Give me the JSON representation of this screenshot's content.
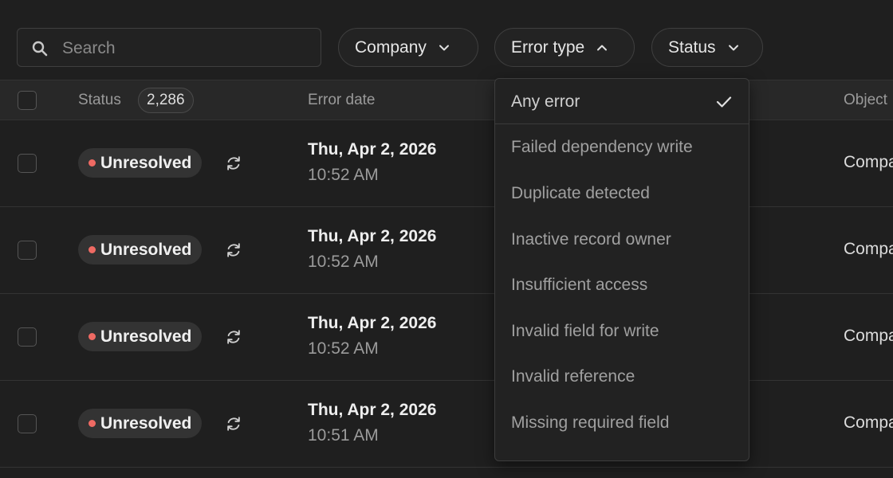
{
  "search": {
    "placeholder": "Search",
    "value": ""
  },
  "filters": {
    "company": "Company",
    "error_type": "Error type",
    "status": "Status"
  },
  "table": {
    "headers": {
      "status": "Status",
      "status_count": "2,286",
      "error_date": "Error date",
      "object": "Object"
    },
    "rows": [
      {
        "status": "Unresolved",
        "date": "Thu, Apr 2, 2026",
        "time": "10:52 AM",
        "object": "Company"
      },
      {
        "status": "Unresolved",
        "date": "Thu, Apr 2, 2026",
        "time": "10:52 AM",
        "object": "Company"
      },
      {
        "status": "Unresolved",
        "date": "Thu, Apr 2, 2026",
        "time": "10:52 AM",
        "object": "Company"
      },
      {
        "status": "Unresolved",
        "date": "Thu, Apr 2, 2026",
        "time": "10:51 AM",
        "object": "Company"
      }
    ]
  },
  "error_type_dropdown": {
    "selected": "Any error",
    "options": [
      "Any error",
      "Failed dependency write",
      "Duplicate detected",
      "Inactive record owner",
      "Insufficient access",
      "Invalid field for write",
      "Invalid reference",
      "Missing required field"
    ]
  },
  "colors": {
    "background": "#1f1f1f",
    "status_dot": "#ef6a63",
    "header_bg": "#282828"
  },
  "icons": {
    "search": "search-icon",
    "chevron_down": "chevron-down-icon",
    "chevron_up": "chevron-up-icon",
    "retry": "retry-icon",
    "check": "check-icon"
  }
}
